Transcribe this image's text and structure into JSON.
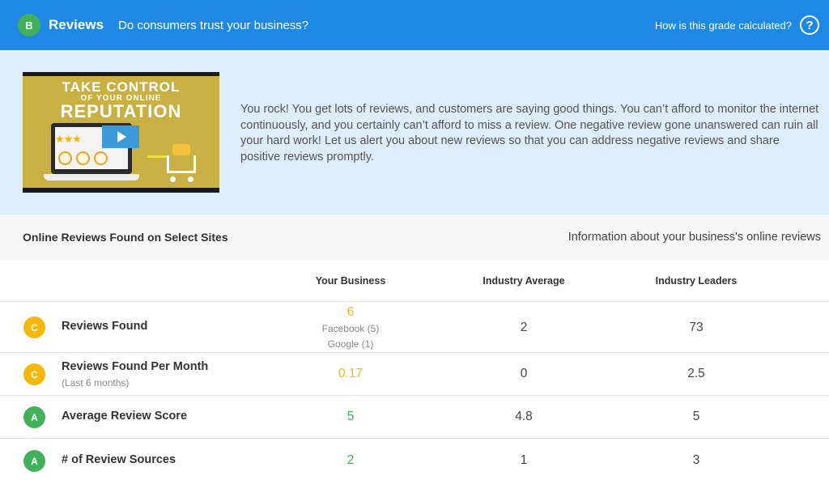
{
  "header": {
    "grade": "B",
    "title": "Reviews",
    "subtitle": "Do consumers trust your business?",
    "grade_link": "How is this grade calculated?",
    "help_glyph": "?",
    "help_icon": "help-circle-icon"
  },
  "info": {
    "video": {
      "line1": "TAKE CONTROL",
      "line2": "OF YOUR ONLINE",
      "line3": "REPUTATION",
      "stars": "★★★"
    },
    "text": "You rock! You get lots of reviews, and customers are saying good things. You can’t afford to monitor the internet continuously, and you certainly can’t afford to miss a review. One negative review gone unanswered can ruin all your hard work! Let us alert you about new reviews so that you can address negative reviews and share positive reviews promptly."
  },
  "section": {
    "title": "Online Reviews Found on Select Sites",
    "info": "Information about your business's online reviews"
  },
  "table": {
    "columns": [
      "Your Business",
      "Industry Average",
      "Industry Leaders"
    ],
    "rows": [
      {
        "grade": "C",
        "label": "Reviews Found",
        "sub": "",
        "business": "6",
        "business_details": [
          "Facebook (5)",
          "Google (1)"
        ],
        "average": "2",
        "leaders": "73"
      },
      {
        "grade": "C",
        "label": "Reviews Found Per Month",
        "sub": "(Last 6 months)",
        "business": "0.17",
        "average": "0",
        "leaders": "2.5"
      },
      {
        "grade": "A",
        "label": "Average Review Score",
        "sub": "",
        "business": "5",
        "average": "4.8",
        "leaders": "5"
      },
      {
        "grade": "A",
        "label": "# of Review Sources",
        "sub": "",
        "business": "2",
        "average": "1",
        "leaders": "3"
      }
    ]
  },
  "colors": {
    "header_bg": "#1e88e5",
    "grade_a": "#43b05c",
    "grade_c": "#f5b70a",
    "info_bg": "#ddedfb"
  }
}
